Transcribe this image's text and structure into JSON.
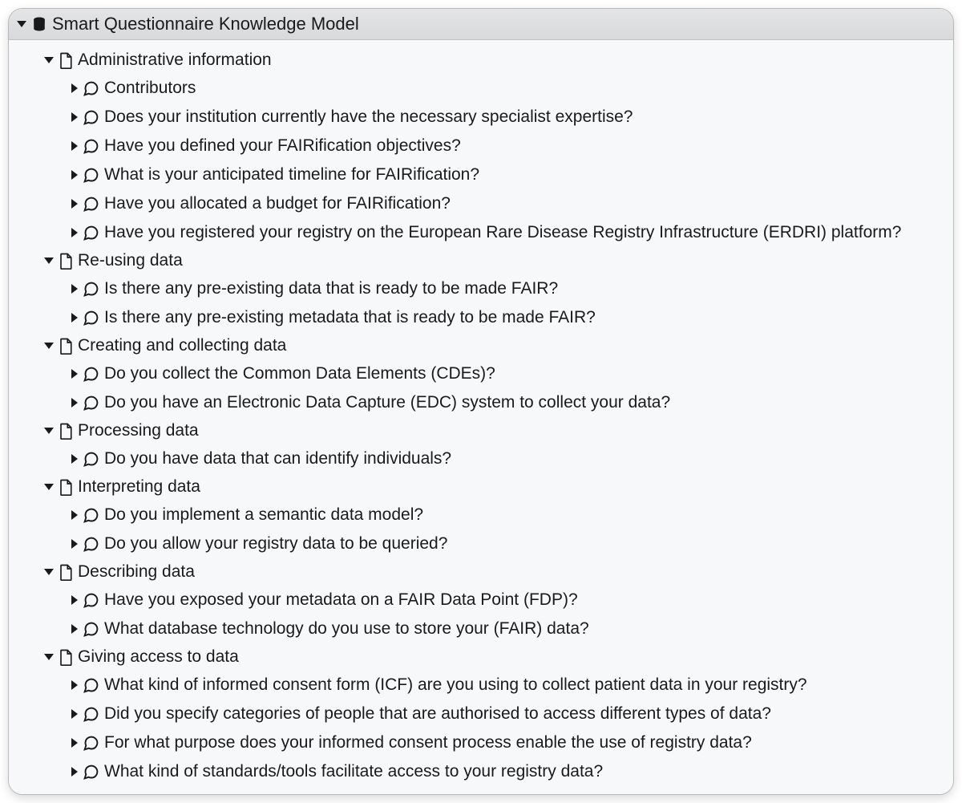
{
  "root": {
    "title": "Smart Questionnaire Knowledge Model"
  },
  "sections": [
    {
      "label": "Administrative information",
      "questions": [
        {
          "label": "Contributors"
        },
        {
          "label": "Does your institution currently have the necessary specialist expertise?"
        },
        {
          "label": "Have you defined your FAIRification objectives?"
        },
        {
          "label": "What is your anticipated timeline for FAIRification?"
        },
        {
          "label": "Have you allocated a budget for FAIRification?"
        },
        {
          "label": "Have you registered your registry on the European Rare Disease Registry Infrastructure (ERDRI) platform?"
        }
      ]
    },
    {
      "label": "Re-using data",
      "questions": [
        {
          "label": "Is there any pre-existing data that is ready to be made FAIR?"
        },
        {
          "label": "Is there any pre-existing metadata that is ready to be made FAIR?"
        }
      ]
    },
    {
      "label": "Creating and collecting data",
      "questions": [
        {
          "label": "Do you collect the Common Data Elements (CDEs)?"
        },
        {
          "label": "Do you have an Electronic Data Capture (EDC) system to collect your data?"
        }
      ]
    },
    {
      "label": "Processing data",
      "questions": [
        {
          "label": "Do you have data that can identify individuals?"
        }
      ]
    },
    {
      "label": "Interpreting data",
      "questions": [
        {
          "label": "Do you implement a semantic data model?"
        },
        {
          "label": "Do you allow your registry data to be queried?"
        }
      ]
    },
    {
      "label": "Describing data",
      "questions": [
        {
          "label": "Have you exposed your metadata on a FAIR Data Point (FDP)?"
        },
        {
          "label": "What database technology do you use to store your (FAIR) data?"
        }
      ]
    },
    {
      "label": "Giving access to data",
      "questions": [
        {
          "label": "What kind of informed consent form (ICF) are you using to collect patient data in your registry?"
        },
        {
          "label": "Did you specify categories of people that are authorised to access different types of data?"
        },
        {
          "label": "For what purpose does your informed consent process enable the use of registry data?"
        },
        {
          "label": "What kind of standards/tools facilitate access to your registry data?"
        }
      ]
    }
  ]
}
